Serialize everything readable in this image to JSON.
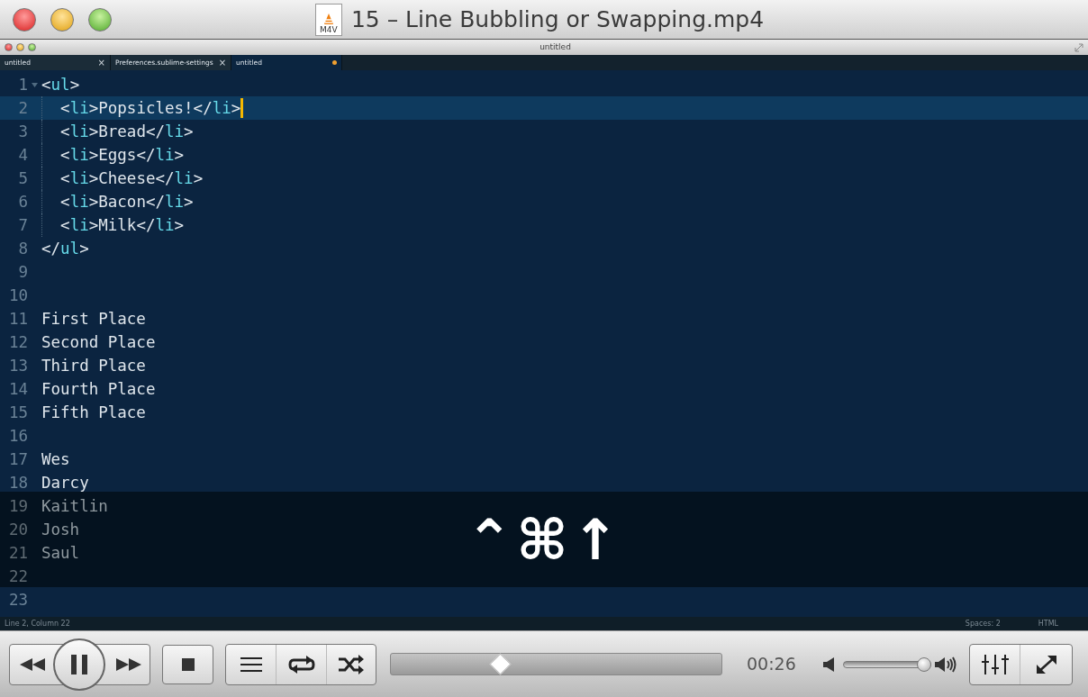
{
  "window": {
    "title": "15 – Line Bubbling or Swapping.mp4",
    "file_badge": "M4V"
  },
  "editor": {
    "title": "untitled",
    "tabs": [
      {
        "label": "untitled",
        "selected": false,
        "dirty": false,
        "close": "×"
      },
      {
        "label": "Preferences.sublime-settings",
        "selected": false,
        "dirty": false,
        "close": "×"
      },
      {
        "label": "untitled",
        "selected": true,
        "dirty": true
      }
    ],
    "lines": [
      {
        "number": "1",
        "text": "<ul>",
        "selected": false,
        "foldable": true,
        "guide": false,
        "dimmed": false
      },
      {
        "number": "2",
        "text": "  <li>Popsicles!</li>",
        "selected": true,
        "foldable": false,
        "guide": true,
        "dimmed": false
      },
      {
        "number": "3",
        "text": "  <li>Bread</li>",
        "selected": false,
        "foldable": false,
        "guide": true,
        "dimmed": false
      },
      {
        "number": "4",
        "text": "  <li>Eggs</li>",
        "selected": false,
        "foldable": false,
        "guide": true,
        "dimmed": false
      },
      {
        "number": "5",
        "text": "  <li>Cheese</li>",
        "selected": false,
        "foldable": false,
        "guide": true,
        "dimmed": false
      },
      {
        "number": "6",
        "text": "  <li>Bacon</li>",
        "selected": false,
        "foldable": false,
        "guide": true,
        "dimmed": false
      },
      {
        "number": "7",
        "text": "  <li>Milk</li>",
        "selected": false,
        "foldable": false,
        "guide": true,
        "dimmed": false
      },
      {
        "number": "8",
        "text": "</ul>",
        "selected": false,
        "foldable": false,
        "guide": false,
        "dimmed": false
      },
      {
        "number": "9",
        "selected": false,
        "foldable": false,
        "guide": false,
        "dimmed": false
      },
      {
        "number": "10",
        "selected": false,
        "foldable": false,
        "guide": false,
        "dimmed": false
      },
      {
        "number": "11",
        "text": "First Place",
        "selected": false,
        "foldable": false,
        "guide": false,
        "dimmed": false
      },
      {
        "number": "12",
        "text": "Second Place",
        "selected": false,
        "foldable": false,
        "guide": false,
        "dimmed": false
      },
      {
        "number": "13",
        "text": "Third Place",
        "selected": false,
        "foldable": false,
        "guide": false,
        "dimmed": false
      },
      {
        "number": "14",
        "text": "Fourth Place",
        "selected": false,
        "foldable": false,
        "guide": false,
        "dimmed": false
      },
      {
        "number": "15",
        "text": "Fifth Place",
        "selected": false,
        "foldable": false,
        "guide": false,
        "dimmed": false
      },
      {
        "number": "16",
        "selected": false,
        "foldable": false,
        "guide": false,
        "dimmed": false
      },
      {
        "number": "17",
        "text": "Wes",
        "selected": false,
        "foldable": false,
        "guide": false,
        "dimmed": false
      },
      {
        "number": "18",
        "text": "Darcy",
        "selected": false,
        "foldable": false,
        "guide": false,
        "dimmed": false
      },
      {
        "number": "19",
        "text": "Kaitlin",
        "selected": false,
        "foldable": false,
        "guide": false,
        "dimmed": true
      },
      {
        "number": "20",
        "text": "Josh",
        "selected": false,
        "foldable": false,
        "guide": false,
        "dimmed": true
      },
      {
        "number": "21",
        "text": "Saul",
        "selected": false,
        "foldable": false,
        "guide": false,
        "dimmed": true
      },
      {
        "number": "22",
        "selected": false,
        "foldable": false,
        "guide": false,
        "dimmed": true
      },
      {
        "number": "23",
        "selected": false,
        "foldable": false,
        "guide": false,
        "dimmed": false
      }
    ],
    "shortcut_overlay": {
      "keys": "⌃⌘↑"
    },
    "status_bar": {
      "position": "Line 2, Column 22",
      "indentation": "Spaces: 2",
      "syntax": "HTML"
    }
  },
  "player": {
    "playing": true,
    "seek": {
      "level": 0.33
    },
    "time": "00:26",
    "volume": {
      "level": 0.93
    }
  }
}
